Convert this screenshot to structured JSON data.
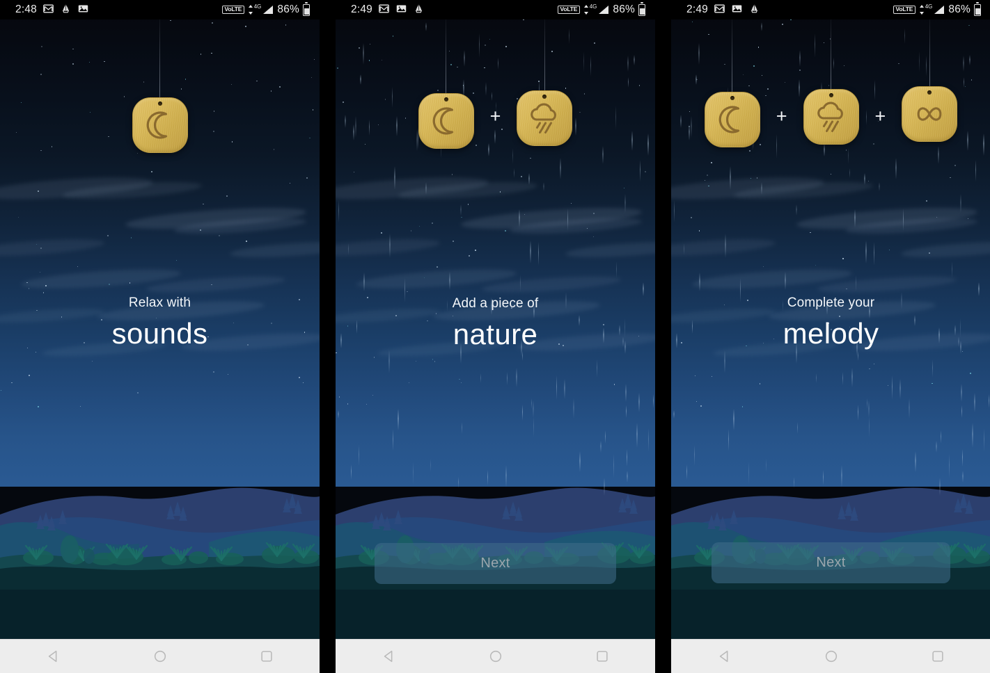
{
  "screens": [
    {
      "id": "screen-1",
      "status_bar": {
        "time": "2:48",
        "left_icons": [
          "gmail-icon",
          "badminton-icon",
          "image-icon"
        ],
        "network_label": "VoLTE",
        "signal_label": "4G",
        "battery_percent": "86%"
      },
      "tiles": [
        {
          "icon": "moon-icon",
          "string_height": 112,
          "tile_top": 0
        }
      ],
      "caption": {
        "small": "Relax with",
        "big": "sounds"
      },
      "next_button": null,
      "has_rain": false,
      "nav": {
        "back": "back-icon",
        "home": "home-icon",
        "recents": "recents-icon"
      }
    },
    {
      "id": "screen-2",
      "status_bar": {
        "time": "2:49",
        "left_icons": [
          "gmail-icon",
          "image-icon",
          "badminton-icon"
        ],
        "network_label": "VoLTE",
        "signal_label": "4G",
        "battery_percent": "86%"
      },
      "tiles": [
        {
          "icon": "moon-icon",
          "string_height": 106,
          "tile_top": 0
        },
        {
          "separator": "+"
        },
        {
          "icon": "rain-cloud-icon",
          "string_height": 102,
          "tile_top": 0
        }
      ],
      "caption": {
        "small": "Add a piece of",
        "big": "nature"
      },
      "next_button": {
        "label": "Next",
        "enabled": false
      },
      "has_rain": true,
      "nav": {
        "back": "back-icon",
        "home": "home-icon",
        "recents": "recents-icon"
      }
    },
    {
      "id": "screen-3",
      "status_bar": {
        "time": "2:49",
        "left_icons": [
          "gmail-icon",
          "image-icon",
          "badminton-icon"
        ],
        "network_label": "VoLTE",
        "signal_label": "4G",
        "battery_percent": "86%"
      },
      "tiles": [
        {
          "icon": "moon-icon",
          "string_height": 104,
          "tile_top": 0
        },
        {
          "separator": "+"
        },
        {
          "icon": "rain-cloud-icon",
          "string_height": 100,
          "tile_top": 0
        },
        {
          "separator": "+"
        },
        {
          "icon": "infinity-icon",
          "string_height": 96,
          "tile_top": 0
        }
      ],
      "caption": {
        "small": "Complete your",
        "big": "melody"
      },
      "next_button": {
        "label": "Next",
        "enabled": false
      },
      "has_rain": true,
      "nav": {
        "back": "back-icon",
        "home": "home-icon",
        "recents": "recents-icon"
      }
    }
  ],
  "colors": {
    "tile_gold": "#d9b958",
    "tile_engrave": "#8a6a2e",
    "sky_top": "#05070c",
    "sky_horizon": "#2a5a93",
    "next_button_bg": "#3e6a88",
    "next_button_text": "#9aa6ad",
    "nav_bar_bg": "#ededed",
    "nav_icon": "#bdbdbd",
    "caption_text": "#ffffff"
  }
}
